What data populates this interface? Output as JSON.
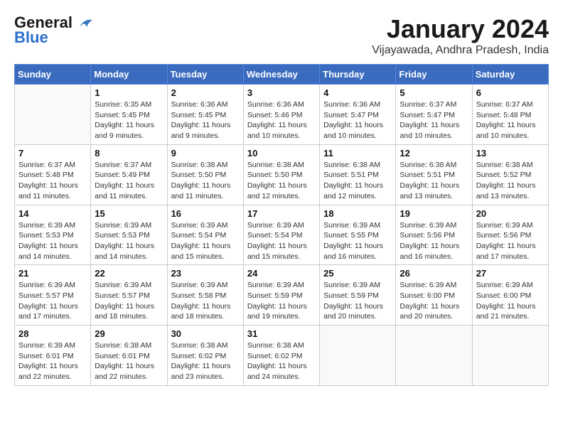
{
  "logo": {
    "line1": "General",
    "line2": "Blue"
  },
  "title": "January 2024",
  "location": "Vijayawada, Andhra Pradesh, India",
  "days_of_week": [
    "Sunday",
    "Monday",
    "Tuesday",
    "Wednesday",
    "Thursday",
    "Friday",
    "Saturday"
  ],
  "weeks": [
    [
      {
        "day": "",
        "info": ""
      },
      {
        "day": "1",
        "info": "Sunrise: 6:35 AM\nSunset: 5:45 PM\nDaylight: 11 hours\nand 9 minutes."
      },
      {
        "day": "2",
        "info": "Sunrise: 6:36 AM\nSunset: 5:45 PM\nDaylight: 11 hours\nand 9 minutes."
      },
      {
        "day": "3",
        "info": "Sunrise: 6:36 AM\nSunset: 5:46 PM\nDaylight: 11 hours\nand 10 minutes."
      },
      {
        "day": "4",
        "info": "Sunrise: 6:36 AM\nSunset: 5:47 PM\nDaylight: 11 hours\nand 10 minutes."
      },
      {
        "day": "5",
        "info": "Sunrise: 6:37 AM\nSunset: 5:47 PM\nDaylight: 11 hours\nand 10 minutes."
      },
      {
        "day": "6",
        "info": "Sunrise: 6:37 AM\nSunset: 5:48 PM\nDaylight: 11 hours\nand 10 minutes."
      }
    ],
    [
      {
        "day": "7",
        "info": "Sunrise: 6:37 AM\nSunset: 5:48 PM\nDaylight: 11 hours\nand 11 minutes."
      },
      {
        "day": "8",
        "info": "Sunrise: 6:37 AM\nSunset: 5:49 PM\nDaylight: 11 hours\nand 11 minutes."
      },
      {
        "day": "9",
        "info": "Sunrise: 6:38 AM\nSunset: 5:50 PM\nDaylight: 11 hours\nand 11 minutes."
      },
      {
        "day": "10",
        "info": "Sunrise: 6:38 AM\nSunset: 5:50 PM\nDaylight: 11 hours\nand 12 minutes."
      },
      {
        "day": "11",
        "info": "Sunrise: 6:38 AM\nSunset: 5:51 PM\nDaylight: 11 hours\nand 12 minutes."
      },
      {
        "day": "12",
        "info": "Sunrise: 6:38 AM\nSunset: 5:51 PM\nDaylight: 11 hours\nand 13 minutes."
      },
      {
        "day": "13",
        "info": "Sunrise: 6:38 AM\nSunset: 5:52 PM\nDaylight: 11 hours\nand 13 minutes."
      }
    ],
    [
      {
        "day": "14",
        "info": "Sunrise: 6:39 AM\nSunset: 5:53 PM\nDaylight: 11 hours\nand 14 minutes."
      },
      {
        "day": "15",
        "info": "Sunrise: 6:39 AM\nSunset: 5:53 PM\nDaylight: 11 hours\nand 14 minutes."
      },
      {
        "day": "16",
        "info": "Sunrise: 6:39 AM\nSunset: 5:54 PM\nDaylight: 11 hours\nand 15 minutes."
      },
      {
        "day": "17",
        "info": "Sunrise: 6:39 AM\nSunset: 5:54 PM\nDaylight: 11 hours\nand 15 minutes."
      },
      {
        "day": "18",
        "info": "Sunrise: 6:39 AM\nSunset: 5:55 PM\nDaylight: 11 hours\nand 16 minutes."
      },
      {
        "day": "19",
        "info": "Sunrise: 6:39 AM\nSunset: 5:56 PM\nDaylight: 11 hours\nand 16 minutes."
      },
      {
        "day": "20",
        "info": "Sunrise: 6:39 AM\nSunset: 5:56 PM\nDaylight: 11 hours\nand 17 minutes."
      }
    ],
    [
      {
        "day": "21",
        "info": "Sunrise: 6:39 AM\nSunset: 5:57 PM\nDaylight: 11 hours\nand 17 minutes."
      },
      {
        "day": "22",
        "info": "Sunrise: 6:39 AM\nSunset: 5:57 PM\nDaylight: 11 hours\nand 18 minutes."
      },
      {
        "day": "23",
        "info": "Sunrise: 6:39 AM\nSunset: 5:58 PM\nDaylight: 11 hours\nand 18 minutes."
      },
      {
        "day": "24",
        "info": "Sunrise: 6:39 AM\nSunset: 5:59 PM\nDaylight: 11 hours\nand 19 minutes."
      },
      {
        "day": "25",
        "info": "Sunrise: 6:39 AM\nSunset: 5:59 PM\nDaylight: 11 hours\nand 20 minutes."
      },
      {
        "day": "26",
        "info": "Sunrise: 6:39 AM\nSunset: 6:00 PM\nDaylight: 11 hours\nand 20 minutes."
      },
      {
        "day": "27",
        "info": "Sunrise: 6:39 AM\nSunset: 6:00 PM\nDaylight: 11 hours\nand 21 minutes."
      }
    ],
    [
      {
        "day": "28",
        "info": "Sunrise: 6:39 AM\nSunset: 6:01 PM\nDaylight: 11 hours\nand 22 minutes."
      },
      {
        "day": "29",
        "info": "Sunrise: 6:38 AM\nSunset: 6:01 PM\nDaylight: 11 hours\nand 22 minutes."
      },
      {
        "day": "30",
        "info": "Sunrise: 6:38 AM\nSunset: 6:02 PM\nDaylight: 11 hours\nand 23 minutes."
      },
      {
        "day": "31",
        "info": "Sunrise: 6:38 AM\nSunset: 6:02 PM\nDaylight: 11 hours\nand 24 minutes."
      },
      {
        "day": "",
        "info": ""
      },
      {
        "day": "",
        "info": ""
      },
      {
        "day": "",
        "info": ""
      }
    ]
  ]
}
